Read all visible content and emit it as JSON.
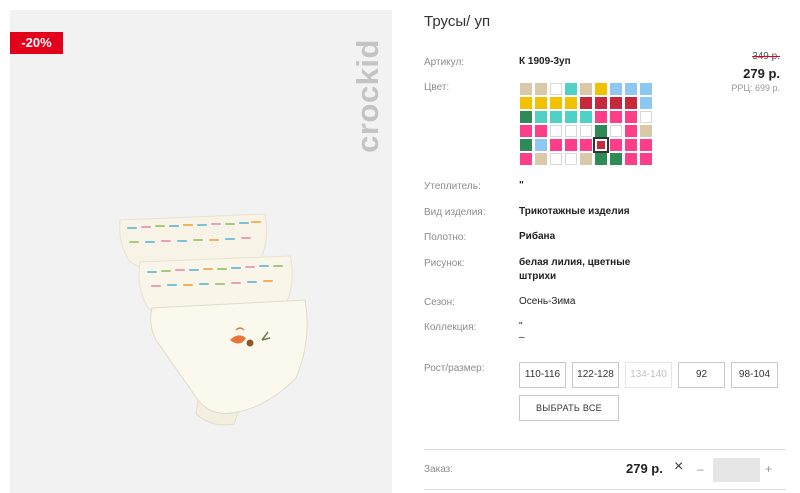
{
  "image": {
    "discount_badge": "-20%",
    "brand_logo": "crockid"
  },
  "product": {
    "title": "Трусы/ уп",
    "price_old": "349 р.",
    "price_new": "279 р.",
    "price_rrp": "РРЦ: 699 р."
  },
  "attributes": {
    "article_label": "Артикул:",
    "article_value": "К 1909-3уп",
    "color_label": "Цвет:",
    "insulation_label": "Утеплитель:",
    "insulation_value": "\"",
    "type_label": "Вид изделия:",
    "type_value": "Трикотажные изделия",
    "fabric_label": "Полотно:",
    "fabric_value": "Рибана",
    "pattern_label": "Рисунок:",
    "pattern_value_line1": "белая лилия, цветные",
    "pattern_value_line2": "штрихи",
    "season_label": "Сезон:",
    "season_value": "Осень-Зима",
    "collection_label": "Коллекция:",
    "collection_value_line1": "\"",
    "collection_value_line2": "–"
  },
  "swatches": [
    "#d9c9a8",
    "#d9c9a8",
    "#ffffff",
    "#4fd1c5",
    "#d9c9a8",
    "#f2c200",
    "#8ec8f2",
    "#8ec8f2",
    "#8ec8f2",
    "#f2c200",
    "#f2c200",
    "#f2c200",
    "#f2c200",
    "#c6283c",
    "#c6283c",
    "#c6283c",
    "#c6283c",
    "#8ec8f2",
    "#2e8b57",
    "#4fd1c5",
    "#4fd1c5",
    "#4fd1c5",
    "#4fd1c5",
    "#ff3e8a",
    "#ff3e8a",
    "#ff3e8a",
    "#ffffff",
    "#ff3e8a",
    "#ff3e8a",
    "#ffffff",
    "#ffffff",
    "#ffffff",
    "#2e8b57",
    "#ffffff",
    "#ff3e8a",
    "#d9c9a8",
    "#2e8b57",
    "#8ec8f2",
    "#ff3e8a",
    "#ff3e8a",
    "#ff3e8a",
    "#c6283c",
    "#ff3e8a",
    "#ff3e8a",
    "#ff3e8a",
    "#ff3e8a",
    "#d9c9a8",
    "#ffffff",
    "#ffffff",
    "#d9c9a8",
    "#2e8b57",
    "#2e8b57",
    "#ff3e8a",
    "#ff3e8a"
  ],
  "selected_swatch_index": 41,
  "sizes": {
    "label": "Рост/размер:",
    "options": [
      "110-116",
      "122-128",
      "134-140",
      "92",
      "98-104"
    ],
    "disabled": [
      false,
      false,
      true,
      false,
      false
    ],
    "select_all": "ВЫБРАТЬ ВСЕ"
  },
  "order": {
    "label": "Заказ:",
    "price": "279 р.",
    "remove_icon": "×",
    "minus": "–",
    "plus": "+",
    "quantity": ""
  }
}
